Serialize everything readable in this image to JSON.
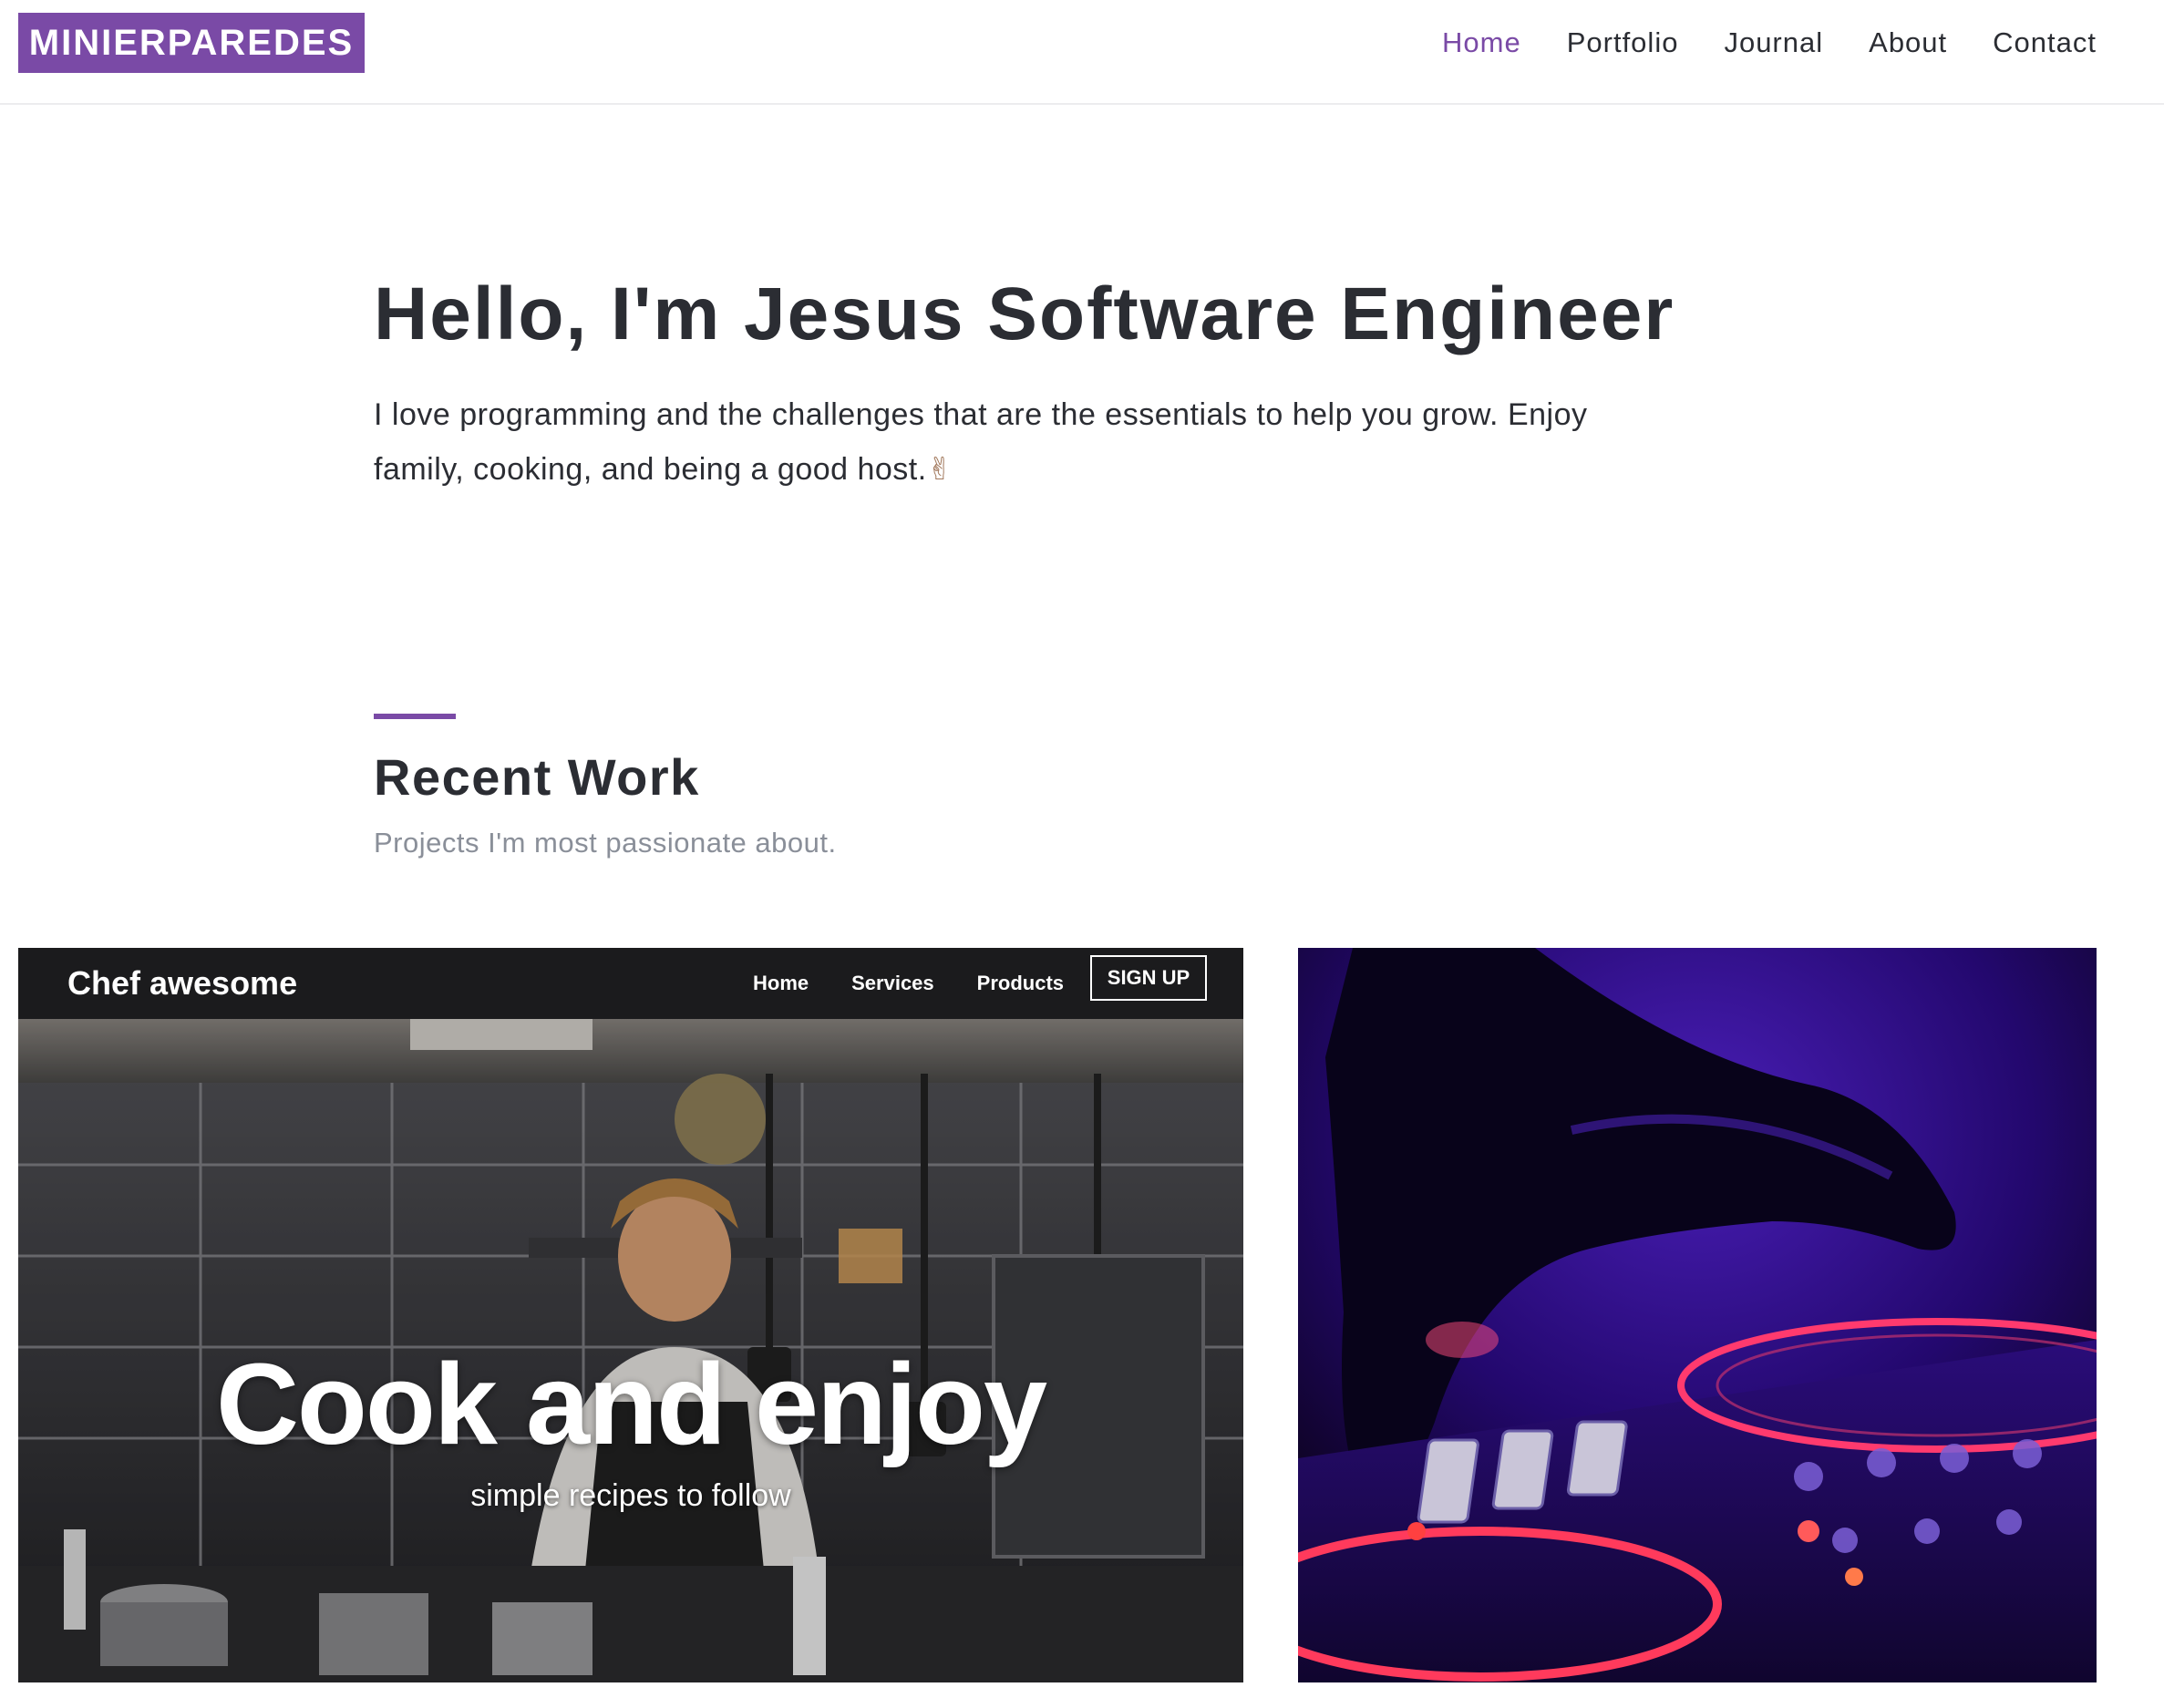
{
  "header": {
    "logo": "MINIERPAREDES",
    "nav": [
      "Home",
      "Portfolio",
      "Journal",
      "About",
      "Contact"
    ],
    "active": "Home"
  },
  "hero": {
    "title": "Hello, I'm Jesus Software Engineer",
    "text": "I love programming and the challenges that are the essentials to help you grow. Enjoy family, cooking, and being a good host.",
    "emoji": "✌"
  },
  "recent": {
    "title": "Recent Work",
    "subtitle": "Projects I'm most passionate about."
  },
  "projects": [
    {
      "mock_brand": "Chef awesome",
      "mock_nav": [
        "Home",
        "Services",
        "Products"
      ],
      "mock_signup": "SIGN UP",
      "headline": "Cook and enjoy",
      "tagline": "simple recipes to follow"
    }
  ],
  "colors": {
    "accent": "#7a4aa6",
    "text": "#2b2d33",
    "muted": "#8a8f99"
  }
}
